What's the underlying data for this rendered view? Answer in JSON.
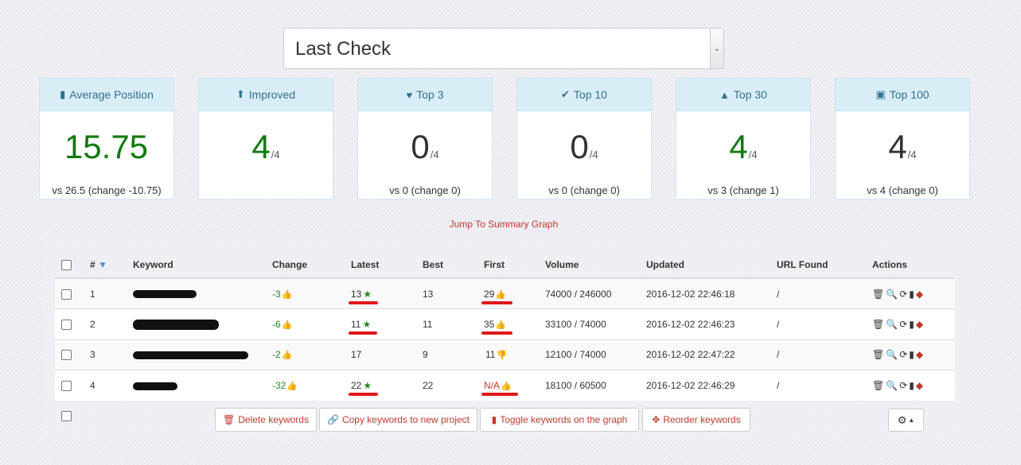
{
  "select": {
    "value": "Last Check"
  },
  "stats": [
    {
      "title": "Average Position",
      "icon": "bar-chart-icon",
      "glyph": "▮",
      "value": "15.75",
      "denom": "",
      "vs": "vs 26.5 (change -10.75)",
      "color": "green"
    },
    {
      "title": "Improved",
      "icon": "arrow-up-icon",
      "glyph": "⬆",
      "value": "4",
      "denom": "/4",
      "vs": "",
      "color": "green"
    },
    {
      "title": "Top 3",
      "icon": "heart-icon",
      "glyph": "♥",
      "value": "0",
      "denom": "/4",
      "vs": "vs 0 (change 0)",
      "color": "dark"
    },
    {
      "title": "Top 10",
      "icon": "check-icon",
      "glyph": "✔",
      "value": "0",
      "denom": "/4",
      "vs": "vs 0 (change 0)",
      "color": "dark"
    },
    {
      "title": "Top 30",
      "icon": "road-icon",
      "glyph": "▲",
      "value": "4",
      "denom": "/4",
      "vs": "vs 3 (change 1)",
      "color": "green"
    },
    {
      "title": "Top 100",
      "icon": "briefcase-icon",
      "glyph": "▣",
      "value": "4",
      "denom": "/4",
      "vs": "vs 4 (change 0)",
      "color": "dark"
    }
  ],
  "jump_link": "Jump To Summary Graph",
  "table": {
    "headers": {
      "num": "#",
      "keyword": "Keyword",
      "change": "Change",
      "latest": "Latest",
      "best": "Best",
      "first": "First",
      "volume": "Volume",
      "updated": "Updated",
      "url": "URL Found",
      "actions": "Actions"
    },
    "rows": [
      {
        "num": "1",
        "change": "-3",
        "latest": "13",
        "best": "13",
        "first": "29",
        "volume": "74000 / 246000",
        "updated": "2016-12-02 22:46:18",
        "url": "/"
      },
      {
        "num": "2",
        "change": "-6",
        "latest": "11",
        "best": "11",
        "first": "35",
        "volume": "33100 / 74000",
        "updated": "2016-12-02 22:46:23",
        "url": "/"
      },
      {
        "num": "3",
        "change": "-2",
        "latest": "17",
        "best": "9",
        "first": "11",
        "volume": "12100 / 74000",
        "updated": "2016-12-02 22:47:22",
        "url": "/"
      },
      {
        "num": "4",
        "change": "-32",
        "latest": "22",
        "best": "22",
        "first": "N/A",
        "volume": "18100 / 60500",
        "updated": "2016-12-02 22:46:29",
        "url": "/"
      }
    ]
  },
  "buttons": {
    "delete": "Delete keywords",
    "copy": "Copy keywords to new project",
    "toggle": "Toggle keywords on the graph",
    "reorder": "Reorder keywords"
  },
  "colors": {
    "accent": "#c0392b",
    "green": "#0f7a0f",
    "panel_head": "#d9edf7"
  }
}
